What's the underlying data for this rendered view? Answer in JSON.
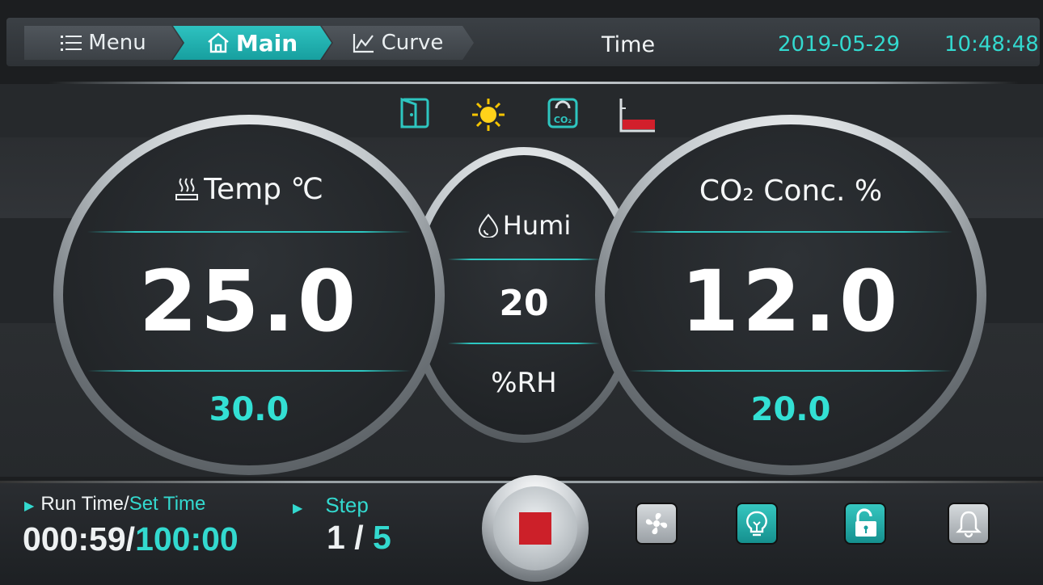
{
  "header": {
    "tabs": [
      {
        "label": "Menu",
        "icon": "list-icon"
      },
      {
        "label": "Main",
        "icon": "home-icon"
      },
      {
        "label": "Curve",
        "icon": "chart-icon"
      }
    ],
    "time_label": "Time",
    "date": "2019-05-29",
    "clock": "10:48:48"
  },
  "status_icons": [
    "door-icon",
    "sun-light-icon",
    "co2-refill-icon",
    "water-level-icon"
  ],
  "temp": {
    "title": "Temp ℃",
    "current": "25.0",
    "setpoint": "30.0"
  },
  "humi": {
    "title": "Humi",
    "current": "20",
    "unit": "%RH"
  },
  "co2": {
    "title": "CO₂ Conc. %",
    "current": "12.0",
    "setpoint": "20.0"
  },
  "footer": {
    "run_label": "Run Time/",
    "set_label": "Set Time",
    "run_value": "000:59/",
    "set_value": "100:00",
    "step_label": "Step",
    "step_current": "1 / ",
    "step_total": "5",
    "buttons": [
      "stop-button",
      "fan-button",
      "light-button",
      "lock-button",
      "alarm-button"
    ]
  },
  "colors": {
    "accent": "#33d9cf",
    "stop": "#cc2029",
    "panel": "#1c1e20"
  }
}
